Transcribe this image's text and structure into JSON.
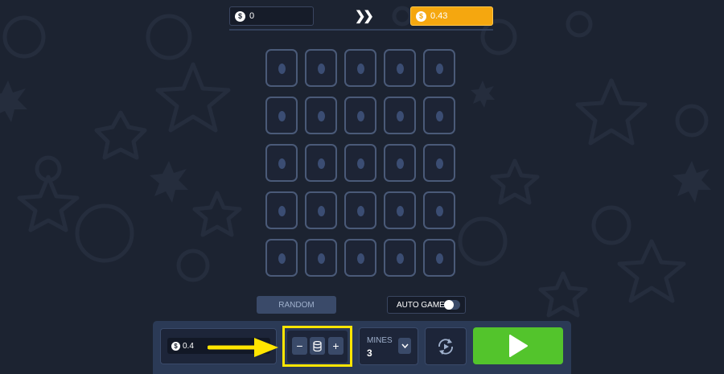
{
  "header": {
    "balance_left": "0",
    "balance_right": "0.43",
    "currency_symbol": "$",
    "progress_icon": "double-chevron-right-icon"
  },
  "board": {
    "rows": 5,
    "cols": 5,
    "tile_state": "hidden"
  },
  "controls": {
    "random_label": "RANDOM",
    "auto_game_label": "AUTO GAME",
    "auto_game_enabled": false
  },
  "bet": {
    "value": "0.4",
    "currency_symbol": "$",
    "decrease_label": "−",
    "increase_label": "+",
    "coins_icon": "coin-stack-icon"
  },
  "mines": {
    "label": "MINES",
    "value": "3"
  },
  "actions": {
    "autoplay_icon": "autoplay-icon",
    "play_icon": "play-icon"
  },
  "colors": {
    "background": "#1c2331",
    "accent_orange": "#f5a70f",
    "play_green": "#53c42c",
    "highlight_yellow": "#ffe500"
  }
}
